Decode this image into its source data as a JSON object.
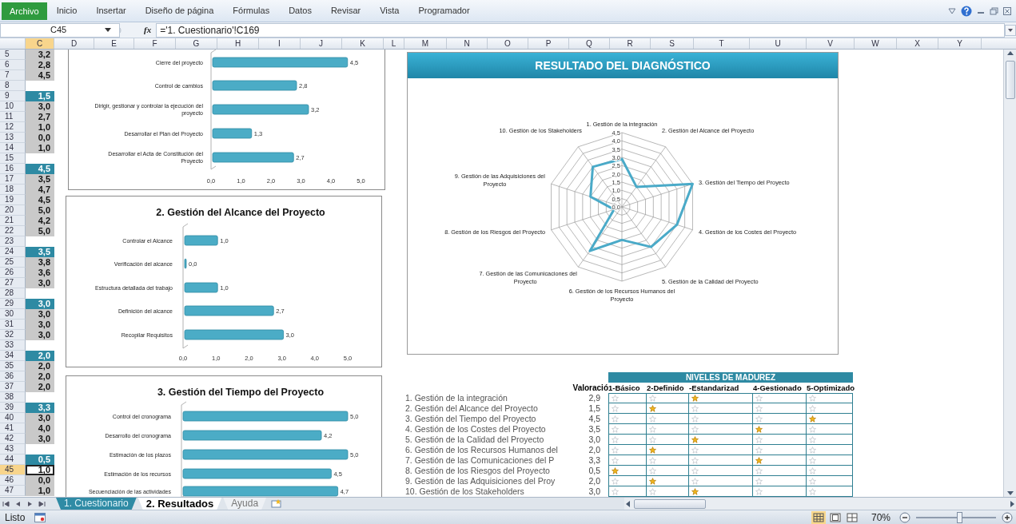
{
  "ribbon": {
    "file_tab": "Archivo",
    "tabs": [
      {
        "label": "Inicio"
      },
      {
        "label": "Insertar"
      },
      {
        "label": "Diseño de página"
      },
      {
        "label": "Fórmulas"
      },
      {
        "label": "Datos"
      },
      {
        "label": "Revisar"
      },
      {
        "label": "Vista"
      },
      {
        "label": "Programador"
      }
    ]
  },
  "formula_bar": {
    "name_box": "C45",
    "fx": "fx",
    "formula": "='1. Cuestionario'!C169"
  },
  "columns": [
    {
      "label": "C",
      "selected": true
    },
    {
      "label": "D",
      "selected": false
    },
    {
      "label": "E",
      "selected": false
    },
    {
      "label": "F",
      "selected": false
    },
    {
      "label": "G",
      "selected": false
    },
    {
      "label": "H",
      "selected": false
    },
    {
      "label": "I",
      "selected": false
    },
    {
      "label": "J",
      "selected": false
    },
    {
      "label": "K",
      "selected": false
    },
    {
      "label": "L",
      "selected": false
    },
    {
      "label": "M",
      "selected": false
    },
    {
      "label": "N",
      "selected": false
    },
    {
      "label": "O",
      "selected": false
    },
    {
      "label": "P",
      "selected": false
    },
    {
      "label": "Q",
      "selected": false
    },
    {
      "label": "R",
      "selected": false
    },
    {
      "label": "S",
      "selected": false
    },
    {
      "label": "T",
      "selected": false
    },
    {
      "label": "U",
      "selected": false
    },
    {
      "label": "V",
      "selected": false
    },
    {
      "label": "W",
      "selected": false
    },
    {
      "label": "X",
      "selected": false
    },
    {
      "label": "Y",
      "selected": false
    }
  ],
  "rows": [
    {
      "number": "5",
      "kind": "item",
      "value": "3,2",
      "selected": false
    },
    {
      "number": "6",
      "kind": "item",
      "value": "2,8",
      "selected": false
    },
    {
      "number": "7",
      "kind": "item",
      "value": "4,5",
      "selected": false
    },
    {
      "number": "8",
      "kind": "blank",
      "selected": false
    },
    {
      "number": "9",
      "kind": "heading",
      "value": "1,5",
      "selected": false
    },
    {
      "number": "10",
      "kind": "item",
      "value": "3,0",
      "selected": false
    },
    {
      "number": "11",
      "kind": "item",
      "value": "2,7",
      "selected": false
    },
    {
      "number": "12",
      "kind": "item",
      "value": "1,0",
      "selected": false
    },
    {
      "number": "13",
      "kind": "item",
      "value": "0,0",
      "selected": false
    },
    {
      "number": "14",
      "kind": "item",
      "value": "1,0",
      "selected": false
    },
    {
      "number": "15",
      "kind": "blank",
      "selected": false
    },
    {
      "number": "16",
      "kind": "heading",
      "value": "4,5",
      "selected": false
    },
    {
      "number": "17",
      "kind": "item",
      "value": "3,5",
      "selected": false
    },
    {
      "number": "18",
      "kind": "item",
      "value": "4,7",
      "selected": false
    },
    {
      "number": "19",
      "kind": "item",
      "value": "4,5",
      "selected": false
    },
    {
      "number": "20",
      "kind": "item",
      "value": "5,0",
      "selected": false
    },
    {
      "number": "21",
      "kind": "item",
      "value": "4,2",
      "selected": false
    },
    {
      "number": "22",
      "kind": "item",
      "value": "5,0",
      "selected": false
    },
    {
      "number": "23",
      "kind": "blank",
      "selected": false
    },
    {
      "number": "24",
      "kind": "heading",
      "value": "3,5",
      "selected": false
    },
    {
      "number": "25",
      "kind": "item",
      "value": "3,8",
      "selected": false
    },
    {
      "number": "26",
      "kind": "item",
      "value": "3,6",
      "selected": false
    },
    {
      "number": "27",
      "kind": "item",
      "value": "3,0",
      "selected": false
    },
    {
      "number": "28",
      "kind": "blank",
      "selected": false
    },
    {
      "number": "29",
      "kind": "heading",
      "value": "3,0",
      "selected": false
    },
    {
      "number": "30",
      "kind": "item",
      "value": "3,0",
      "selected": false
    },
    {
      "number": "31",
      "kind": "item",
      "value": "3,0",
      "selected": false
    },
    {
      "number": "32",
      "kind": "item",
      "value": "3,0",
      "selected": false
    },
    {
      "number": "33",
      "kind": "blank",
      "selected": false
    },
    {
      "number": "34",
      "kind": "heading",
      "value": "2,0",
      "selected": false
    },
    {
      "number": "35",
      "kind": "item",
      "value": "2,0",
      "selected": false
    },
    {
      "number": "36",
      "kind": "item",
      "value": "2,0",
      "selected": false
    },
    {
      "number": "37",
      "kind": "item",
      "value": "2,0",
      "selected": false
    },
    {
      "number": "38",
      "kind": "blank",
      "selected": false
    },
    {
      "number": "39",
      "kind": "heading",
      "value": "3,3",
      "selected": false
    },
    {
      "number": "40",
      "kind": "item",
      "value": "3,0",
      "selected": false
    },
    {
      "number": "41",
      "kind": "item",
      "value": "4,0",
      "selected": false
    },
    {
      "number": "42",
      "kind": "item",
      "value": "3,0",
      "selected": false
    },
    {
      "number": "43",
      "kind": "blank",
      "selected": false
    },
    {
      "number": "44",
      "kind": "heading",
      "value": "0,5",
      "selected": false
    },
    {
      "number": "45",
      "kind": "item",
      "value": "1,0",
      "selected": true
    },
    {
      "number": "46",
      "kind": "item",
      "value": "0,0",
      "selected": false
    },
    {
      "number": "47",
      "kind": "item",
      "value": "1,0",
      "selected": false
    }
  ],
  "bar_charts": [
    {
      "chart_data": {
        "type": "bar",
        "orientation": "horizontal",
        "categories": [
          "Cierre del proyecto",
          "Control de cambios",
          "Dirigir, gestionar y controlar la ejecución del proyecto",
          "Desarrollar el Plan del Proyecto",
          "Desarrollar el Acta de Constitución del Proyecto"
        ],
        "values": [
          4.5,
          2.8,
          3.2,
          1.3,
          2.7
        ],
        "value_labels": [
          "4,5",
          "2,8",
          "3,2",
          "1,3",
          "2,7"
        ],
        "xlim": [
          0,
          5
        ],
        "xticks": [
          {
            "value": 0,
            "label": "0,0"
          },
          {
            "value": 1,
            "label": "1,0"
          },
          {
            "value": 2,
            "label": "2,0"
          },
          {
            "value": 3,
            "label": "3,0"
          },
          {
            "value": 4,
            "label": "4,0"
          },
          {
            "value": 5,
            "label": "5,0"
          }
        ]
      }
    },
    {
      "chart_data": {
        "type": "bar",
        "orientation": "horizontal",
        "title": "2. Gestión del Alcance del Proyecto",
        "categories": [
          "Controlar el Alcance",
          "Verificación del alcance",
          "Estructura detallada del trabajo",
          "Definición del alcance",
          "Recopilar Requisitos"
        ],
        "values": [
          1.0,
          0.0,
          1.0,
          2.7,
          3.0
        ],
        "value_labels": [
          "1,0",
          "0,0",
          "1,0",
          "2,7",
          "3,0"
        ],
        "xlim": [
          0,
          5
        ],
        "xticks": [
          {
            "value": 0,
            "label": "0,0"
          },
          {
            "value": 1,
            "label": "1,0"
          },
          {
            "value": 2,
            "label": "2,0"
          },
          {
            "value": 3,
            "label": "3,0"
          },
          {
            "value": 4,
            "label": "4,0"
          },
          {
            "value": 5,
            "label": "5,0"
          }
        ]
      }
    },
    {
      "chart_data": {
        "type": "bar",
        "orientation": "horizontal",
        "title": "3. Gestión del Tiempo del Proyecto",
        "categories": [
          "Control del cronograma",
          "Desarrollo del cronograma",
          "Estimación de los plazos",
          "Estimación de los recursos",
          "Secuenciación de las actividades"
        ],
        "values": [
          5.0,
          4.2,
          5.0,
          4.5,
          4.7
        ],
        "value_labels": [
          "5,0",
          "4,2",
          "5,0",
          "4,5",
          "4,7"
        ]
      }
    }
  ],
  "diagnosis": {
    "title": "RESULTADO DEL DIAGNÓSTICO",
    "chart_data": {
      "type": "radar",
      "categories": [
        "1. Gestión de la integración",
        "2. Gestión del Alcance del Proyecto",
        "3. Gestión del Tiempo del Proyecto",
        "4. Gestión de los Costes del Proyecto",
        "5. Gestión de la Calidad del Proyecto",
        "6. Gestión de los Recursos Humanos del Proyecto",
        "7. Gestión de las Comunicaciones del Proyecto",
        "8. Gestión de los Riesgos del Proyecto",
        "9. Gestión de las Adquisiciones del Proyecto",
        "10. Gestión de los Stakeholders"
      ],
      "values": [
        2.9,
        1.5,
        4.5,
        3.5,
        3.0,
        2.0,
        3.3,
        0.5,
        2.0,
        3.0
      ],
      "ylim": [
        0,
        4.5
      ],
      "yticks": [
        {
          "value": 0,
          "label": "0,0"
        },
        {
          "value": 0.5,
          "label": "0,5"
        },
        {
          "value": 1,
          "label": "1,0"
        },
        {
          "value": 1.5,
          "label": "1,5"
        },
        {
          "value": 2,
          "label": "2,0"
        },
        {
          "value": 2.5,
          "label": "2,5"
        },
        {
          "value": 3,
          "label": "3,0"
        },
        {
          "value": 3.5,
          "label": "3,5"
        },
        {
          "value": 4,
          "label": "4,0"
        },
        {
          "value": 4.5,
          "label": "4,5"
        }
      ]
    }
  },
  "maturity": {
    "title": "NIVELES DE MADUREZ",
    "value_header": "Valoració",
    "level_headers": [
      "1-Básico",
      "2-Definido",
      "-Estandarizad",
      "4-Gestionado",
      "5-Optimizado"
    ],
    "rows": [
      {
        "label": "1. Gestión de la integración",
        "value": "2,9",
        "stars_filled": [
          false,
          false,
          true,
          false,
          false
        ]
      },
      {
        "label": "2. Gestión del Alcance del Proyecto",
        "value": "1,5",
        "stars_filled": [
          false,
          true,
          false,
          false,
          false
        ]
      },
      {
        "label": "3. Gestión del Tiempo del Proyecto",
        "value": "4,5",
        "stars_filled": [
          false,
          false,
          false,
          false,
          true
        ]
      },
      {
        "label": "4. Gestión de los Costes del Proyecto",
        "value": "3,5",
        "stars_filled": [
          false,
          false,
          false,
          true,
          false
        ]
      },
      {
        "label": "5. Gestión de la Calidad del Proyecto",
        "value": "3,0",
        "stars_filled": [
          false,
          false,
          true,
          false,
          false
        ]
      },
      {
        "label": "6. Gestión de los Recursos Humanos del",
        "value": "2,0",
        "stars_filled": [
          false,
          true,
          false,
          false,
          false
        ]
      },
      {
        "label": "7. Gestión de las Comunicaciones del P",
        "value": "3,3",
        "stars_filled": [
          false,
          false,
          false,
          true,
          false
        ]
      },
      {
        "label": "8. Gestión de los Riesgos del Proyecto",
        "value": "0,5",
        "stars_filled": [
          true,
          false,
          false,
          false,
          false
        ]
      },
      {
        "label": "9. Gestión de las Adquisiciones del Proy",
        "value": "2,0",
        "stars_filled": [
          false,
          true,
          false,
          false,
          false
        ]
      },
      {
        "label": "10. Gestión de los Stakeholders",
        "value": "3,0",
        "stars_filled": [
          false,
          false,
          true,
          false,
          false
        ]
      }
    ]
  },
  "sheet_tabs": [
    {
      "label": "1. Cuestionario",
      "selected": false,
      "color": "#2f8ba5"
    },
    {
      "label": "2. Resultados",
      "selected": true
    },
    {
      "label": "Ayuda",
      "selected": false
    }
  ],
  "status_bar": {
    "text": "Listo",
    "view_buttons": [
      {
        "selected": true
      },
      {
        "selected": false
      },
      {
        "selected": false
      }
    ],
    "zoom": "70%",
    "zoom_slider": {
      "level": 0.55
    }
  }
}
